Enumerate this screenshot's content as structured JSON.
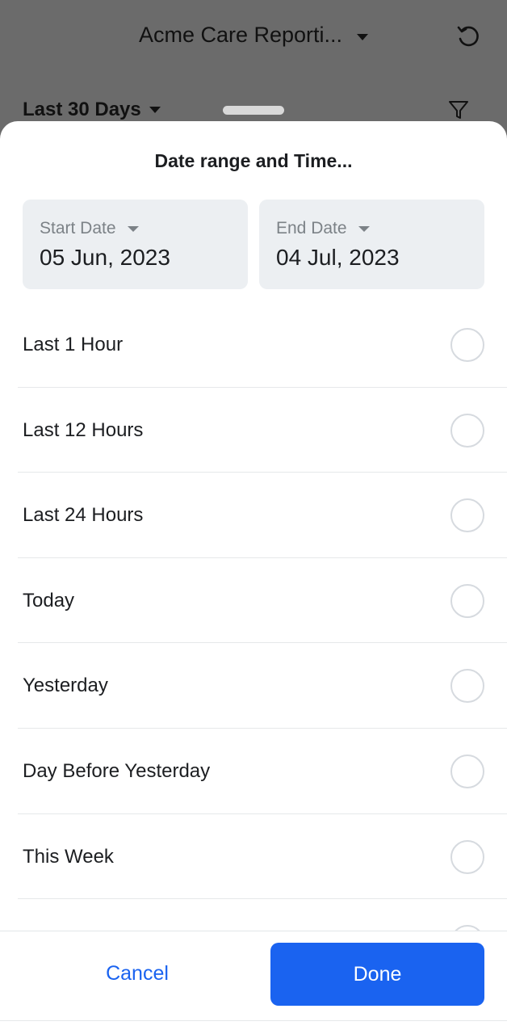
{
  "background": {
    "app_title": "Acme Care Reporti...",
    "range_label": "Last 30 Days",
    "icons": [
      "refresh-icon",
      "filter-icon",
      "chevron-down-icon"
    ]
  },
  "sheet": {
    "title": "Date range and Time...",
    "start_date": {
      "label": "Start Date",
      "value": "05 Jun, 2023"
    },
    "end_date": {
      "label": "End Date",
      "value": "04 Jul, 2023"
    },
    "options": [
      {
        "label": "Last 1 Hour",
        "selected": false
      },
      {
        "label": "Last 12 Hours",
        "selected": false
      },
      {
        "label": "Last 24 Hours",
        "selected": false
      },
      {
        "label": "Today",
        "selected": false
      },
      {
        "label": "Yesterday",
        "selected": false
      },
      {
        "label": "Day Before Yesterday",
        "selected": false
      },
      {
        "label": "This Week",
        "selected": false
      }
    ]
  },
  "footer": {
    "cancel_label": "Cancel",
    "done_label": "Done"
  },
  "colors": {
    "accent": "#1a63f0",
    "overlay": "#6b6b6b",
    "date_box_bg": "#eceff2"
  }
}
